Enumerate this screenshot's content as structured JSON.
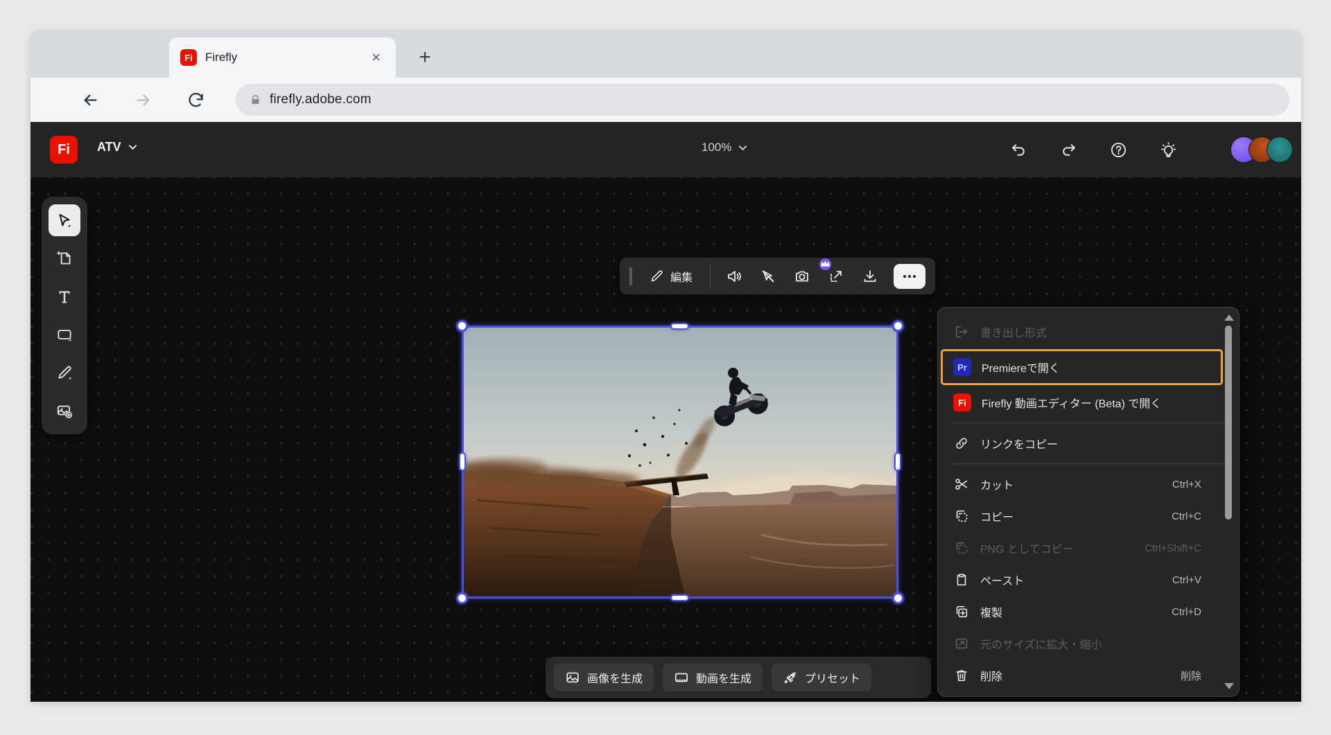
{
  "browser": {
    "tab_title": "Firefly",
    "close_tab_glyph": "×",
    "new_tab_glyph": "+",
    "url": "firefly.adobe.com"
  },
  "app_header": {
    "logo_text": "Fi",
    "project_name": "ATV",
    "zoom_level": "100%"
  },
  "left_toolbar": {
    "tools": [
      {
        "icon": "select-cursor-icon",
        "active": true
      },
      {
        "icon": "add-page-icon",
        "active": false
      },
      {
        "icon": "text-tool-icon",
        "active": false
      },
      {
        "icon": "shape-tool-icon",
        "active": false
      },
      {
        "icon": "draw-tool-icon",
        "active": false
      },
      {
        "icon": "add-image-icon",
        "active": false
      }
    ]
  },
  "float_toolbar": {
    "edit_label": "編集",
    "icons": [
      "volume-icon",
      "pointer-off-icon",
      "camera-icon",
      "upscale-premium-icon",
      "download-icon",
      "more-icon"
    ]
  },
  "context_menu": {
    "items": [
      {
        "label": "書き出し形式",
        "shortcut": "",
        "icon": "export-icon",
        "disabled": true,
        "highlighted": false
      },
      {
        "label": "Premiereで開く",
        "shortcut": "",
        "icon": "premiere-badge",
        "badge_text": "Pr",
        "disabled": false,
        "highlighted": true
      },
      {
        "label": "Firefly 動画エディター (Beta) で開く",
        "shortcut": "",
        "icon": "firefly-badge",
        "badge_text": "Fi",
        "disabled": false,
        "highlighted": false
      },
      {
        "label": "リンクをコピー",
        "shortcut": "",
        "icon": "link-icon",
        "disabled": false,
        "highlighted": false
      },
      {
        "label": "カット",
        "shortcut": "Ctrl+X",
        "icon": "scissors-icon",
        "disabled": false,
        "highlighted": false
      },
      {
        "label": "コピー",
        "shortcut": "Ctrl+C",
        "icon": "copy-icon",
        "disabled": false,
        "highlighted": false
      },
      {
        "label": "PNG としてコピー",
        "shortcut": "Ctrl+Shift+C",
        "icon": "copy-icon",
        "disabled": true,
        "highlighted": false
      },
      {
        "label": "ペースト",
        "shortcut": "Ctrl+V",
        "icon": "paste-icon",
        "disabled": false,
        "highlighted": false
      },
      {
        "label": "複製",
        "shortcut": "Ctrl+D",
        "icon": "duplicate-icon",
        "disabled": false,
        "highlighted": false
      },
      {
        "label": "元のサイズに拡大・縮小",
        "shortcut": "",
        "icon": "resize-icon",
        "disabled": true,
        "highlighted": false
      },
      {
        "label": "削除",
        "shortcut": "削除",
        "icon": "trash-icon",
        "disabled": false,
        "highlighted": false
      }
    ]
  },
  "bottom_bar": {
    "buttons": [
      {
        "label": "画像を生成",
        "icon": "image-icon"
      },
      {
        "label": "動画を生成",
        "icon": "film-icon"
      },
      {
        "label": "プリセット",
        "icon": "rocket-icon"
      }
    ]
  },
  "colors": {
    "highlight_orange": "#f2a23b",
    "selection_blue": "#4b50df",
    "firefly_red": "#eb1000",
    "premiere_blue": "#2228b8",
    "premium_purple": "#7c55f5",
    "header_bg": "#242424",
    "canvas_bg": "#0e0e0e",
    "menu_bg": "#262626"
  }
}
